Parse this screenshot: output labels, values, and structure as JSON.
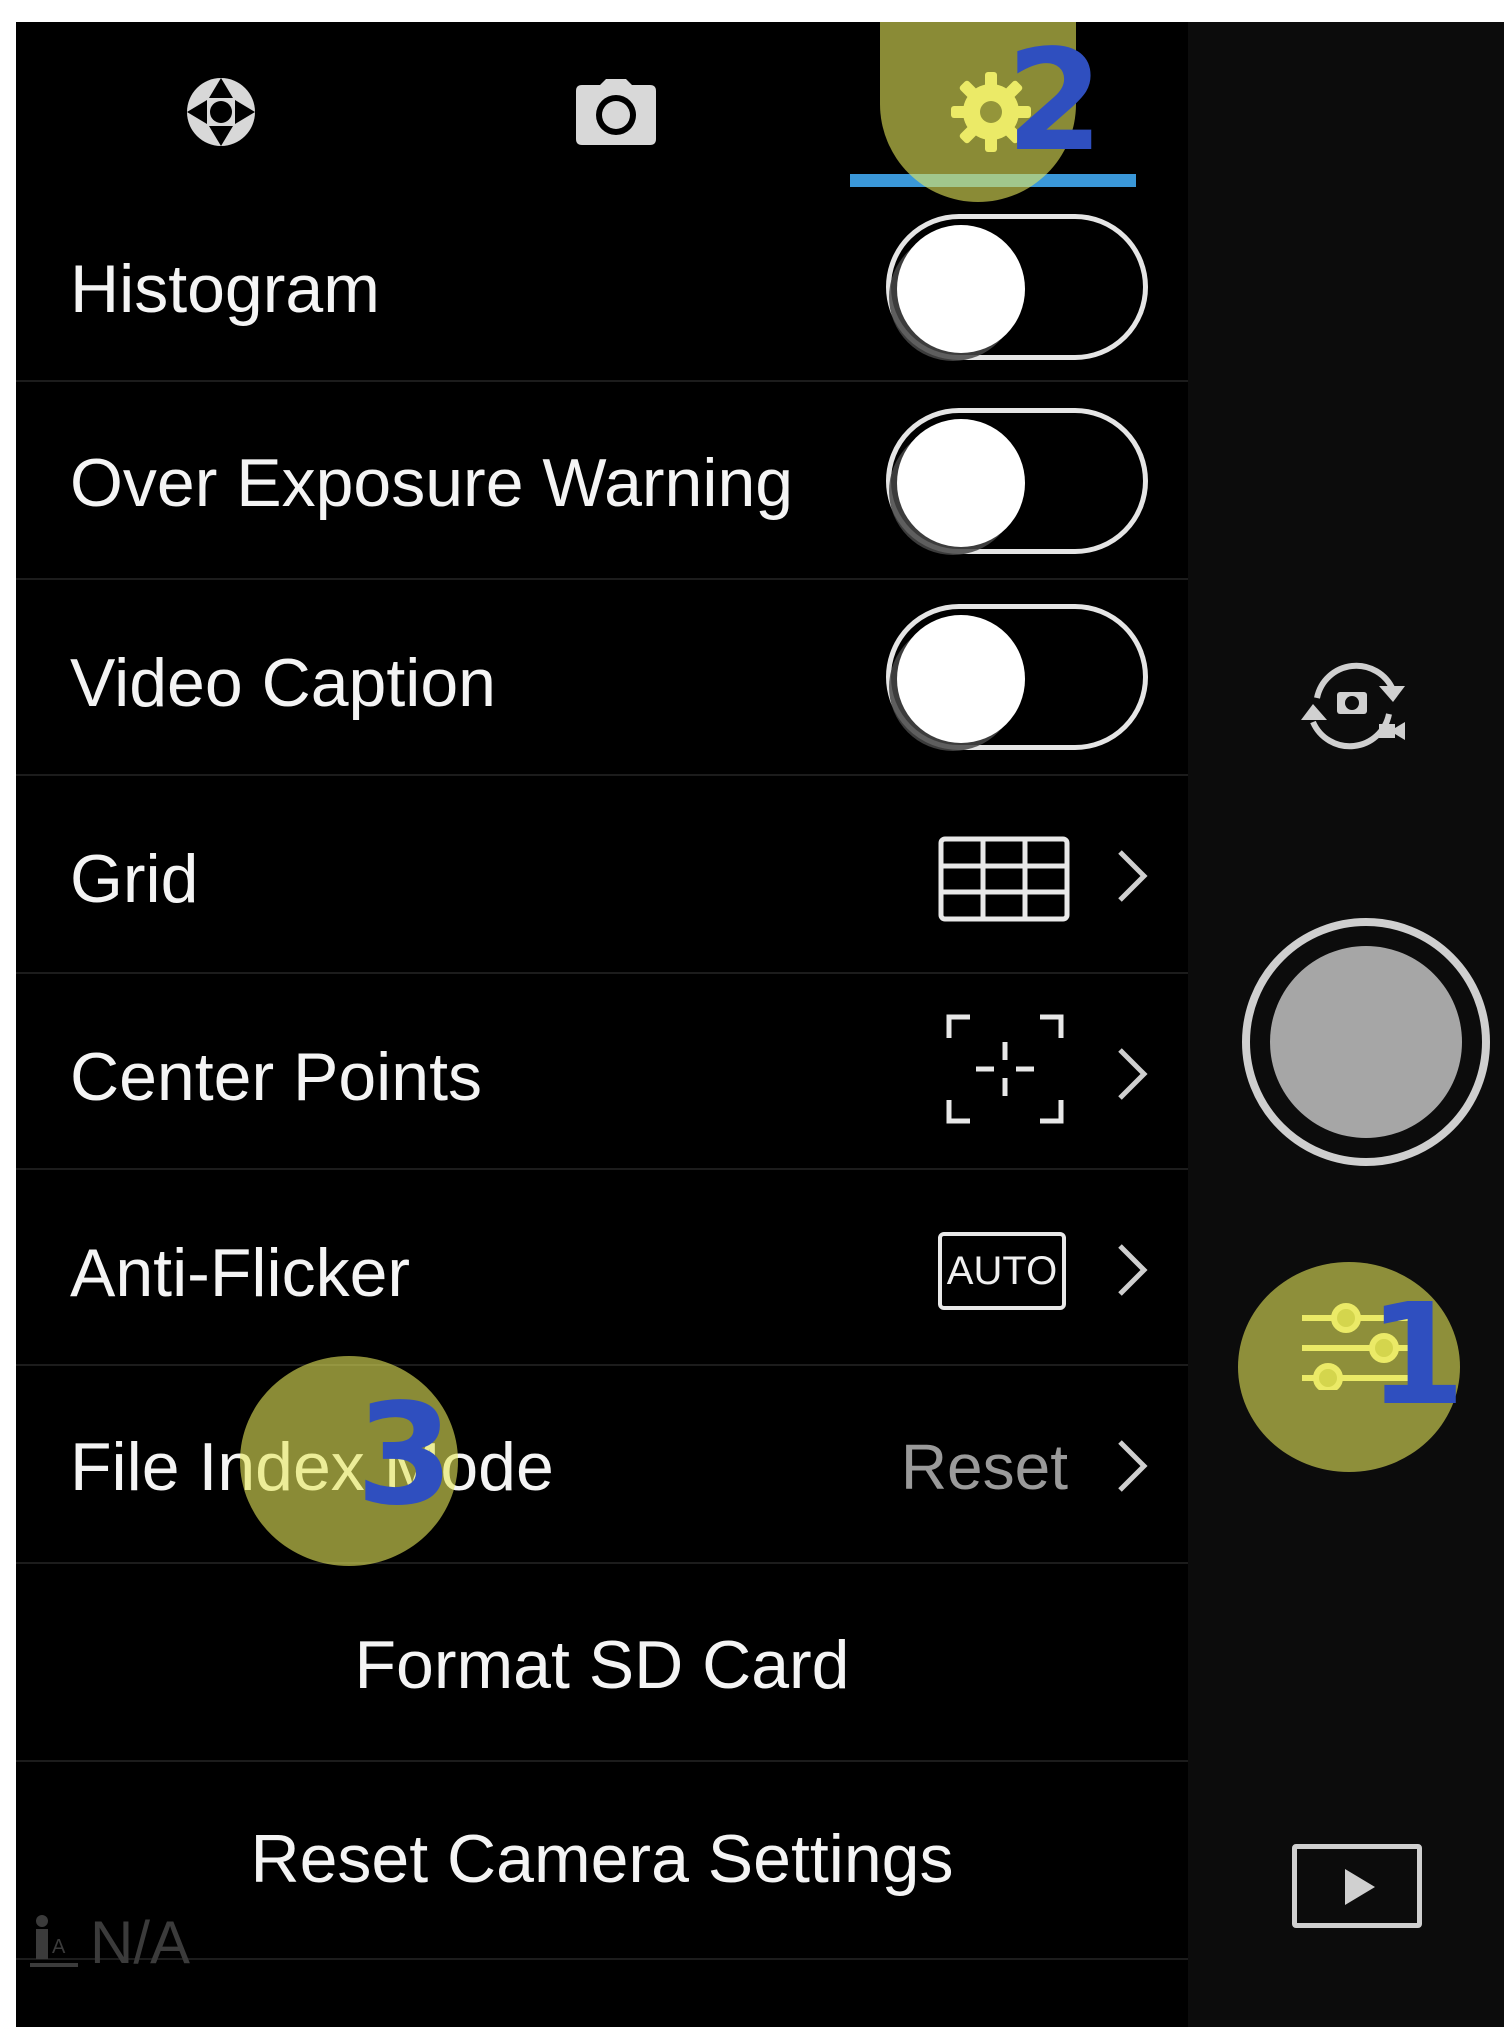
{
  "tabs": [
    {
      "icon": "aperture-icon"
    },
    {
      "icon": "camera-icon"
    },
    {
      "icon": "gear-icon",
      "active": true
    }
  ],
  "settings": {
    "histogram": {
      "label": "Histogram",
      "enabled": false
    },
    "over_exposure": {
      "label": "Over Exposure Warning",
      "enabled": false
    },
    "video_caption": {
      "label": "Video Caption",
      "enabled": false
    },
    "grid": {
      "label": "Grid",
      "icon": "grid-icon"
    },
    "center_points": {
      "label": "Center Points",
      "icon": "center-points-icon"
    },
    "anti_flicker": {
      "label": "Anti-Flicker",
      "badge": "AUTO"
    },
    "file_index_mode": {
      "label": "File Index Mode",
      "value": "Reset"
    },
    "format_sd": {
      "label": "Format SD Card"
    },
    "reset_camera": {
      "label": "Reset Camera Settings"
    }
  },
  "sidebar": {
    "switch_mode_icon": "photo-video-switch-icon",
    "shutter_icon": "shutter-button",
    "settings_icon": "sliders-icon",
    "playback_icon": "playback-icon"
  },
  "annotations": {
    "marker_1": "1",
    "marker_2": "2",
    "marker_3": "3"
  },
  "watermark": {
    "text": "N/A"
  },
  "colors": {
    "accent": "#3a97d8",
    "highlight": "#e6e85a",
    "marker": "#2f4fbf",
    "gear_active": "#f2ee7a"
  }
}
